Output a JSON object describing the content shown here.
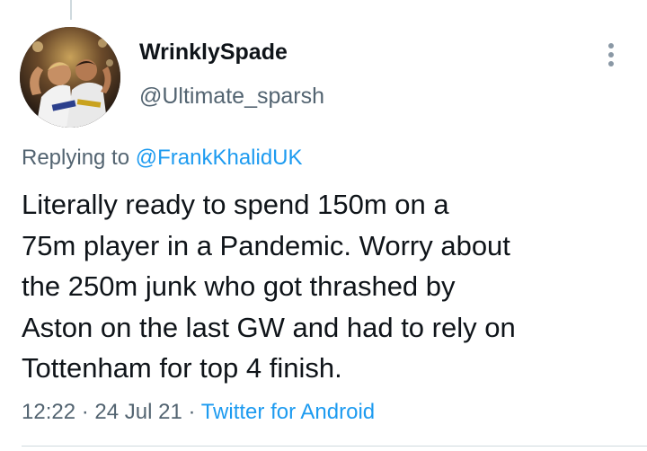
{
  "tweet": {
    "display_name": "WrinklySpade",
    "handle": "@Ultimate_sparsh",
    "replying_prefix": "Replying to",
    "replying_to": "@FrankKhalidUK",
    "text_lines": [
      "Literally ready to spend 150m on a",
      "75m player in a Pandemic. Worry about",
      "the 250m junk who got thrashed by",
      "Aston on the last GW and had to rely on",
      "Tottenham for top 4 finish."
    ],
    "time": "12:22",
    "separator": "·",
    "date": "24 Jul 21",
    "source": "Twitter for Android"
  },
  "icons": {
    "menu": "more-vertical-icon",
    "avatar": "avatar-photo"
  },
  "colors": {
    "text_primary": "#0f1419",
    "text_secondary": "#536471",
    "link": "#1d9bf0",
    "divider": "#cfd9de"
  }
}
